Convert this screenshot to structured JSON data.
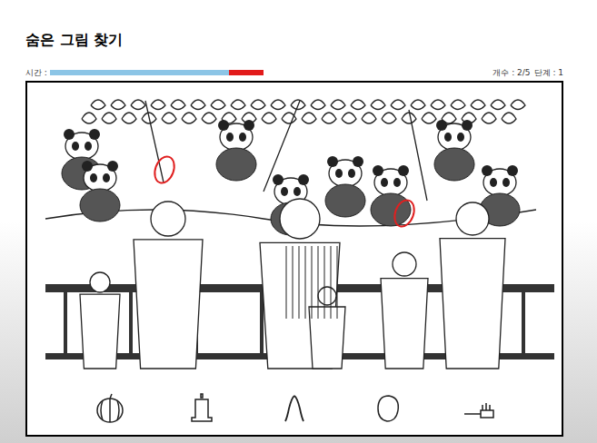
{
  "title": "숨은 그림 찾기",
  "timer": {
    "label": "시간 :",
    "level": 0.84
  },
  "status": {
    "count": "개수 : 2/5",
    "stage": "단계 : 1"
  },
  "found_markers": 2,
  "targets": [
    {
      "kind": "pumpkin"
    },
    {
      "kind": "bell"
    },
    {
      "kind": "wishbone"
    },
    {
      "kind": "face"
    },
    {
      "kind": "brush"
    }
  ]
}
